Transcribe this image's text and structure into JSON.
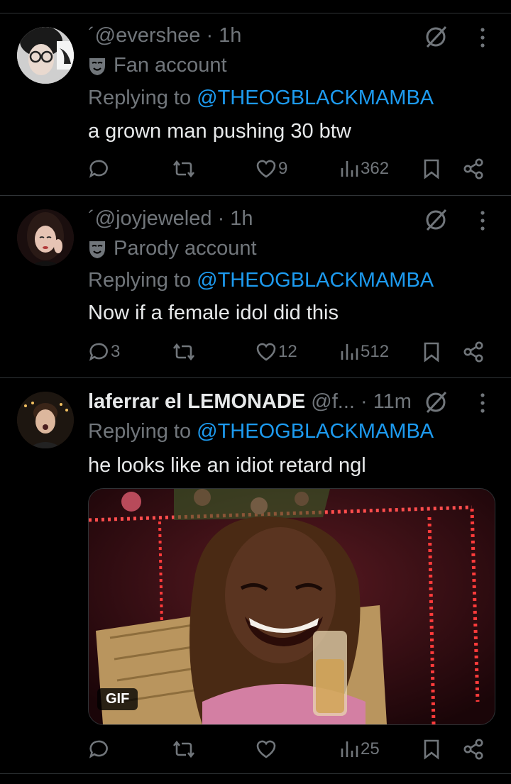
{
  "tweets": [
    {
      "handle_line": "´@evershee · 1h",
      "label": "Fan account",
      "reply_prefix": "Replying to ",
      "reply_to": "@THEOGBLACKMAMBA",
      "text": "a grown man pushing 30 btw",
      "stats": {
        "replies": "",
        "retweets": "",
        "likes": "9",
        "views": "362"
      }
    },
    {
      "handle_line": "´@joyjeweled · 1h",
      "label": "Parody account",
      "reply_prefix": "Replying to ",
      "reply_to": "@THEOGBLACKMAMBA",
      "text": "Now if a female idol did this",
      "stats": {
        "replies": "3",
        "retweets": "",
        "likes": "12",
        "views": "512"
      }
    },
    {
      "display_name": "laferrar el LEMONADE",
      "handle_time": " @f... · 11m",
      "reply_prefix": "Replying to ",
      "reply_to": "@THEOGBLACKMAMBA",
      "text": "he looks like an idiot retard ngl",
      "media_badge": "GIF",
      "stats": {
        "replies": "",
        "retweets": "",
        "likes": "",
        "views": "25"
      }
    }
  ],
  "colors": {
    "background": "#000000",
    "text": "#e7e9ea",
    "muted": "#71767b",
    "link": "#1d9bf0",
    "divider": "#2f3336"
  }
}
